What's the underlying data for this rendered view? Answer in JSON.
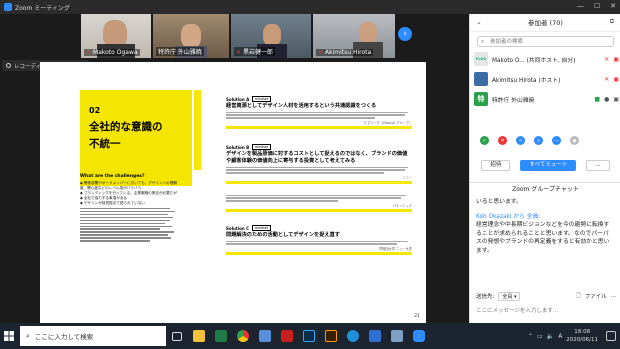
{
  "window": {
    "title": "Zoom ミーティング"
  },
  "video_strip": {
    "tiles": [
      {
        "name": "Makoto Ogawa",
        "muted": true
      },
      {
        "name": "特許庁 外山雅暁",
        "muted": false
      },
      {
        "name": "黒岩健一郎",
        "muted": true
      },
      {
        "name": "Akimitsu Hirota",
        "muted": true
      }
    ]
  },
  "recording": {
    "label": "レコーディングしています..."
  },
  "document": {
    "section_num": "02",
    "title_line1": "全社的な意識の",
    "title_line2": "不統一",
    "left_head": "What are the challenges?",
    "left_bullets": [
      "◆ 関係部署やボードメンバーにおいても、デザインへの理解度、関心度などのレベル感がバラバラ",
      "◆ ブランディングを行っている。企業戦略の策定が必要だが",
      "◆ 全社で協力する事項がある",
      "◆ デザインが経営視点で語られていない"
    ],
    "solutions": [
      {
        "label": "Solution A",
        "tag": "mindset",
        "title": "経営資源としてデザイン人材を活用するという共通認識をつくる",
        "source": "ビズリーチ（Visional グループ）"
      },
      {
        "label": "Solution B",
        "tag": "mindset",
        "title": "デザインを製品原価に対するコストとして捉えるのではなく、ブランドの価値や顧客体験の価値向上に寄与する投資として考えてみる",
        "source": "ソニー"
      },
      {
        "label": "Solution B'",
        "tag": "",
        "title": "",
        "source": "パナソニック"
      },
      {
        "label": "Solution C",
        "tag": "mindset",
        "title": "問題解決のための活動としてデザインを捉え直す",
        "source": "早稲田大学 ニュー大学"
      }
    ],
    "page_number": "21"
  },
  "panel": {
    "title": "参加者 (70)",
    "search_placeholder": "参加者の検索",
    "participants": [
      {
        "name": "Makoto O... (共同ホスト, 自分)",
        "avatar": "FLUG",
        "color": "#e6e6e6"
      },
      {
        "name": "Akimitsu Hirota (ホスト)",
        "avatar": "",
        "color": "#3a6ea5"
      },
      {
        "name": "特許庁 外山雅暁",
        "avatar": "特",
        "color": "#2aa14a"
      }
    ],
    "buttons": {
      "invite": "招待",
      "mute_all": "すべてミュート",
      "more": "..."
    },
    "chat_title": "Zoom グループチャット",
    "chat_pre": "いると思います。",
    "chat_from": "Koh Okazaki から 全員:",
    "chat_msg": "経営理念や中長期ビジョンなどを今の趨勢に転換することが求められることと思います。なのでパーパスの発想やブランドの再定義をすると有効かと思います。",
    "send_to_label": "送信先:",
    "send_to_value": "全員 ▾",
    "file_label": "ファイル",
    "more_label": "...",
    "input_placeholder": "ここにメッセージを入力します..."
  },
  "taskbar": {
    "search_text": "ここに入力して検索",
    "time": "18:08",
    "date": "2020/06/11"
  }
}
